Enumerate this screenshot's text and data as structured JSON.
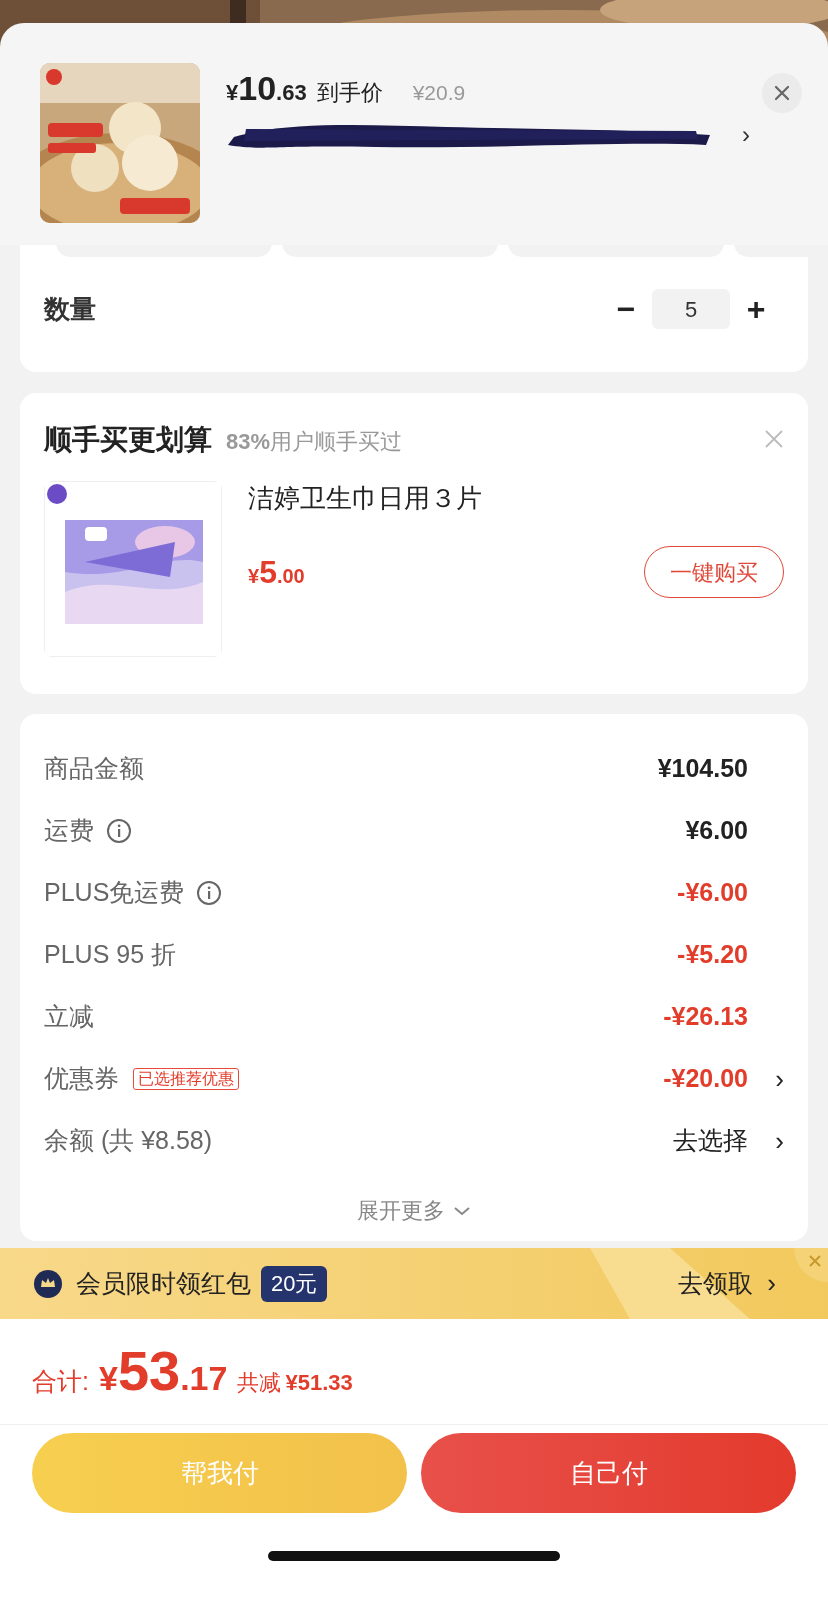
{
  "product": {
    "price_currency": "¥",
    "price_integer": "10",
    "price_decimal": ".63",
    "price_label": "到手价",
    "original_price": "¥20.9",
    "chevron": "›"
  },
  "quantity": {
    "label": "数量",
    "value": "5",
    "minus": "−",
    "plus": "+"
  },
  "addon": {
    "title": "顺手买更划算",
    "stat_bold": "83%",
    "stat_text": "用户顺手买过",
    "item_name": "洁婷卫生巾日用３片",
    "price_currency": "¥",
    "price_integer": "5",
    "price_decimal": ".00",
    "button": "一键购买"
  },
  "costs": [
    {
      "label": "商品金额",
      "info": false,
      "value": "¥104.50",
      "kind": "amount"
    },
    {
      "label": "运费",
      "info": true,
      "value": "¥6.00",
      "kind": "amount"
    },
    {
      "label": "PLUS免运费",
      "info": true,
      "value": "-¥6.00",
      "kind": "discount"
    },
    {
      "label": "PLUS 95 折",
      "info": false,
      "value": "-¥5.20",
      "kind": "discount"
    },
    {
      "label": "立减",
      "info": false,
      "value": "-¥26.13",
      "kind": "discount"
    },
    {
      "label": "优惠券",
      "info": false,
      "badge": "已选推荐优惠",
      "value": "-¥20.00",
      "kind": "discount",
      "chevron": "›"
    },
    {
      "label": "余额 (共 ¥8.58)",
      "info": false,
      "value": "去选择",
      "kind": "link",
      "chevron": "›"
    }
  ],
  "expand": "展开更多",
  "banner": {
    "text": "会员限时领红包",
    "amount": "20元",
    "action": "去领取",
    "chevron": "›"
  },
  "total": {
    "label": "合计:",
    "currency": "¥",
    "integer": "53",
    "decimal": ".17",
    "saved_label": "共减",
    "saved": "¥51.33"
  },
  "buttons": {
    "secondary": "帮我付",
    "primary": "自己付"
  }
}
